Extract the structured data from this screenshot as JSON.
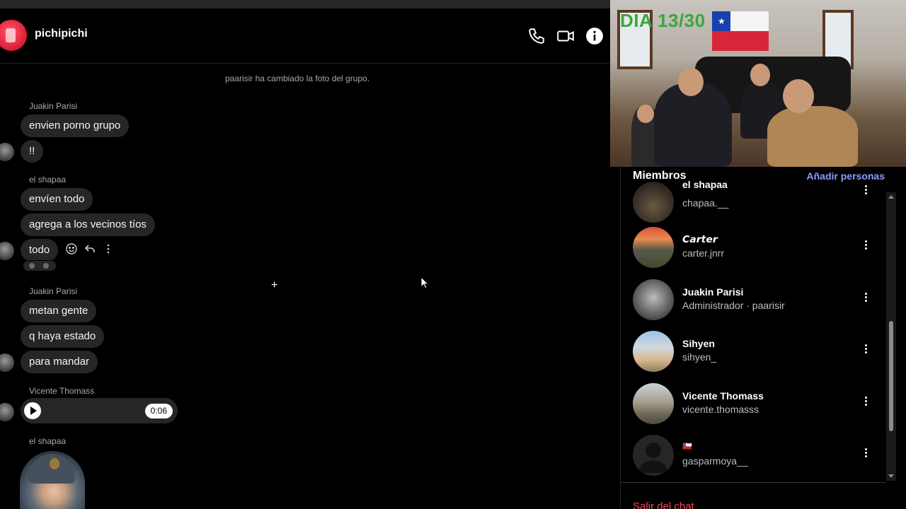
{
  "chat": {
    "group_name": "pichipichi",
    "system_message": "paarisir ha cambiado la foto del grupo.",
    "icons": [
      "phone-icon",
      "video-camera-icon",
      "info-icon"
    ],
    "blocks": [
      {
        "sender": "Juakin Parisi",
        "messages": [
          "envien porno grupo",
          "!!"
        ]
      },
      {
        "sender": "el shapaa",
        "messages": [
          "envíen todo",
          "agrega a los vecinos tíos",
          "todo"
        ]
      },
      {
        "sender": "Juakin Parisi",
        "messages": [
          "metan gente",
          "q haya estado",
          "para mandar"
        ]
      },
      {
        "sender": "Vicente Thomass",
        "voice_duration": "0:06"
      },
      {
        "sender": "el shapaa"
      }
    ]
  },
  "stream": {
    "day_counter": "DIA 13/30"
  },
  "members_panel": {
    "title": "Miembros",
    "add_label": "Añadir personas",
    "members": [
      {
        "name": "el shapaa",
        "handle": "chapaa.__"
      },
      {
        "name": "𝘾𝙖𝙧𝙩𝙚𝙧",
        "handle": "carter.jnrr"
      },
      {
        "name": "Juakin Parisi",
        "handle": "Administrador · paarisir"
      },
      {
        "name": "Sihyen",
        "handle": "sihyen_"
      },
      {
        "name": "Vicente Thomass",
        "handle": "vicente.thomasss"
      },
      {
        "name": "🇨🇱",
        "handle": "gasparmoya__"
      }
    ],
    "leave_label": "Salir del chat"
  },
  "colors": {
    "bubble": "#262626",
    "accent_link": "#8c9cff",
    "danger": "#ed4956"
  }
}
